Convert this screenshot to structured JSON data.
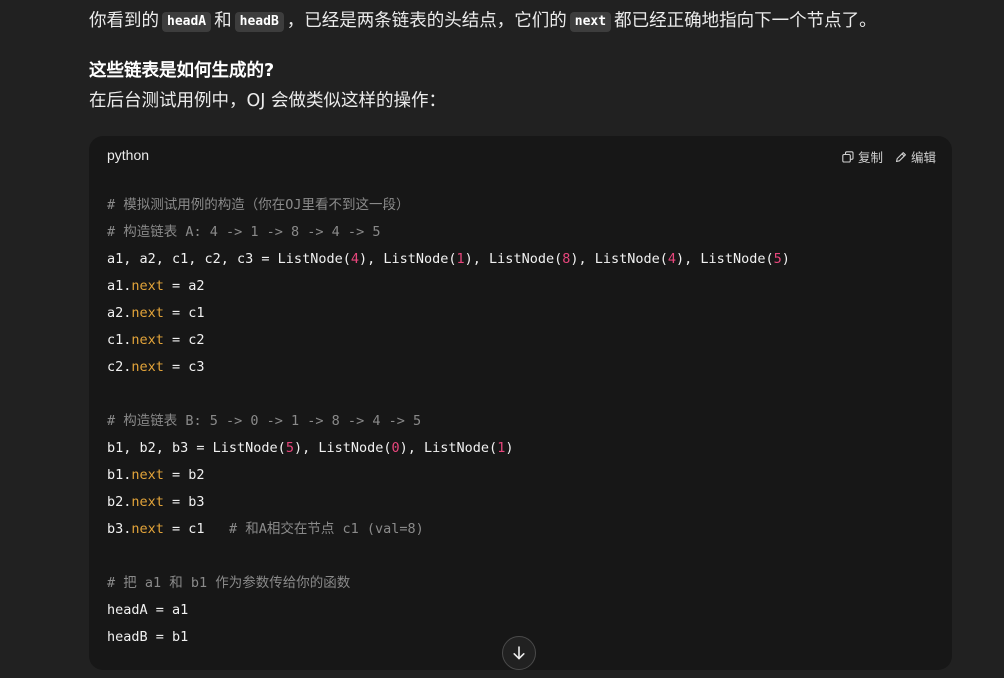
{
  "message": {
    "p1": {
      "t1": "你看到的",
      "c1": "headA",
      "t2": "和",
      "c2": "headB",
      "t3": "，已经是两条链表的头结点，它们的",
      "c3": "next",
      "t4": "都已经正确地指向下一个节点了。"
    },
    "heading": "这些链表是如何生成的?",
    "p3": "在后台测试用例中，OJ 会做类似这样的操作："
  },
  "code_block": {
    "language": "python",
    "copy_label": "复制",
    "edit_label": "编辑",
    "lines": [
      [
        {
          "t": "# 模拟测试用例的构造（你在OJ里看不到这一段）",
          "k": "comment"
        }
      ],
      [
        {
          "t": "# 构造链表 A: 4 -> 1 -> 8 -> 4 -> 5",
          "k": "comment"
        }
      ],
      [
        {
          "t": "a1, a2, c1, c2, c3 = ListNode("
        },
        {
          "t": "4",
          "k": "num"
        },
        {
          "t": "), ListNode("
        },
        {
          "t": "1",
          "k": "num"
        },
        {
          "t": "), ListNode("
        },
        {
          "t": "8",
          "k": "num"
        },
        {
          "t": "), ListNode("
        },
        {
          "t": "4",
          "k": "num"
        },
        {
          "t": "), ListNode("
        },
        {
          "t": "5",
          "k": "num"
        },
        {
          "t": ")"
        }
      ],
      [
        {
          "t": "a1."
        },
        {
          "t": "next",
          "k": "attr"
        },
        {
          "t": " = a2"
        }
      ],
      [
        {
          "t": "a2."
        },
        {
          "t": "next",
          "k": "attr"
        },
        {
          "t": " = c1"
        }
      ],
      [
        {
          "t": "c1."
        },
        {
          "t": "next",
          "k": "attr"
        },
        {
          "t": " = c2"
        }
      ],
      [
        {
          "t": "c2."
        },
        {
          "t": "next",
          "k": "attr"
        },
        {
          "t": " = c3"
        }
      ],
      [],
      [
        {
          "t": "# 构造链表 B: 5 -> 0 -> 1 -> 8 -> 4 -> 5",
          "k": "comment"
        }
      ],
      [
        {
          "t": "b1, b2, b3 = ListNode("
        },
        {
          "t": "5",
          "k": "num"
        },
        {
          "t": "), ListNode("
        },
        {
          "t": "0",
          "k": "num"
        },
        {
          "t": "), ListNode("
        },
        {
          "t": "1",
          "k": "num"
        },
        {
          "t": ")"
        }
      ],
      [
        {
          "t": "b1."
        },
        {
          "t": "next",
          "k": "attr"
        },
        {
          "t": " = b2"
        }
      ],
      [
        {
          "t": "b2."
        },
        {
          "t": "next",
          "k": "attr"
        },
        {
          "t": " = b3"
        }
      ],
      [
        {
          "t": "b3."
        },
        {
          "t": "next",
          "k": "attr"
        },
        {
          "t": " = c1   "
        },
        {
          "t": "# 和A相交在节点 c1 (val=8)",
          "k": "comment"
        }
      ],
      [],
      [
        {
          "t": "# 把 a1 和 b1 作为参数传给你的函数",
          "k": "comment"
        }
      ],
      [
        {
          "t": "headA = a1"
        }
      ],
      [
        {
          "t": "headB = b1"
        }
      ]
    ]
  },
  "colors": {
    "page_bg": "#212121",
    "code_bg": "#171717",
    "comment": "#8a8a8a",
    "attribute": "#e3a43a",
    "number": "#e8467c"
  },
  "icons": {
    "copy": "copy-icon",
    "edit": "edit-pencil-icon",
    "scroll": "arrow-down-icon"
  }
}
